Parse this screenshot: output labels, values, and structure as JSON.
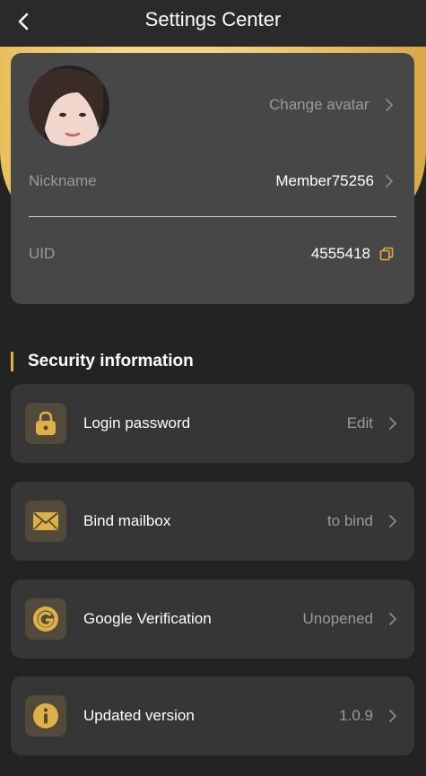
{
  "header": {
    "title": "Settings Center"
  },
  "profile": {
    "change_avatar_label": "Change avatar",
    "nickname_label": "Nickname",
    "nickname_value": "Member75256",
    "uid_label": "UID",
    "uid_value": "4555418"
  },
  "security": {
    "title": "Security information",
    "items": [
      {
        "label": "Login password",
        "value": "Edit",
        "icon": "lock-icon"
      },
      {
        "label": "Bind mailbox",
        "value": "to bind",
        "icon": "mail-icon"
      },
      {
        "label": "Google Verification",
        "value": "Unopened",
        "icon": "google-icon"
      },
      {
        "label": "Updated version",
        "value": "1.0.9",
        "icon": "info-icon"
      }
    ]
  },
  "colors": {
    "accent": "#e0b048",
    "card": "#474747",
    "item_bg": "#363636",
    "background": "#232323"
  }
}
